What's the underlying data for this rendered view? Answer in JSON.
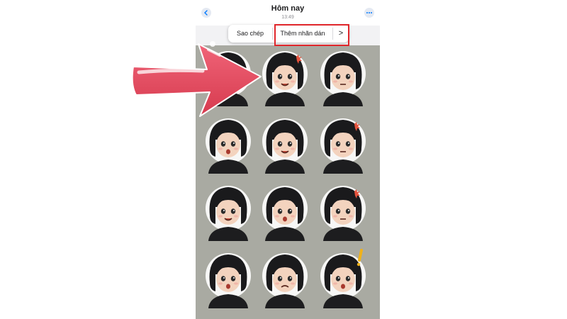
{
  "header": {
    "title": "Hôm nay",
    "time": "13:49"
  },
  "context_menu": {
    "items": [
      "Sao chép",
      "Thêm nhãn dán"
    ],
    "next_label": ">"
  },
  "icons": {
    "back": "chevron-left-icon",
    "more": "ellipsis-icon",
    "arrow": "pointer-arrow-icon"
  },
  "colors": {
    "accent": "#007aff",
    "highlight": "#e0262b",
    "arrow": "#e14a5e",
    "sticker_bg": "#a9aaa2"
  }
}
